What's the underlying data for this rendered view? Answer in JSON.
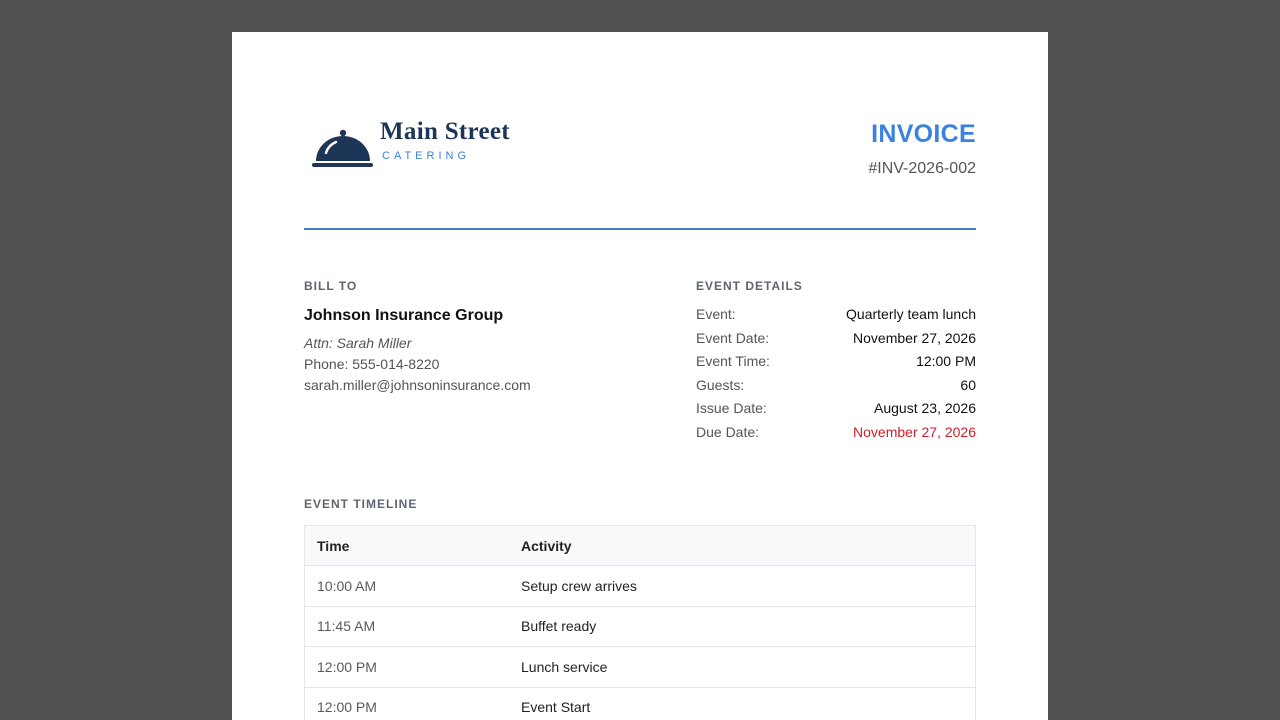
{
  "brand": {
    "name": "Main Street",
    "subtitle": "CATERING",
    "logo_icon": "cloche-icon",
    "color_primary": "#1d3557",
    "color_accent": "#3b82d6"
  },
  "invoice": {
    "title": "INVOICE",
    "number": "#INV-2026-002"
  },
  "bill_to": {
    "label": "BILL TO",
    "company": "Johnson Insurance Group",
    "attn": "Attn: Sarah Miller",
    "phone": "Phone: 555-014-8220",
    "email": "sarah.miller@johnsoninsurance.com"
  },
  "event_details": {
    "label": "EVENT DETAILS",
    "rows": [
      {
        "label": "Event:",
        "value": "Quarterly team lunch"
      },
      {
        "label": "Event Date:",
        "value": "November 27, 2026"
      },
      {
        "label": "Event Time:",
        "value": "12:00 PM"
      },
      {
        "label": "Guests:",
        "value": "60"
      },
      {
        "label": "Issue Date:",
        "value": "August 23, 2026"
      },
      {
        "label": "Due Date:",
        "value": "November 27, 2026"
      }
    ],
    "due_color": "#d0202a"
  },
  "timeline": {
    "label": "EVENT TIMELINE",
    "headers": [
      "Time",
      "Activity"
    ],
    "rows": [
      {
        "time": "10:00 AM",
        "activity": "Setup crew arrives"
      },
      {
        "time": "11:45 AM",
        "activity": "Buffet ready"
      },
      {
        "time": "12:00 PM",
        "activity": "Lunch service"
      },
      {
        "time": "12:00 PM",
        "activity": "Event Start"
      }
    ]
  }
}
